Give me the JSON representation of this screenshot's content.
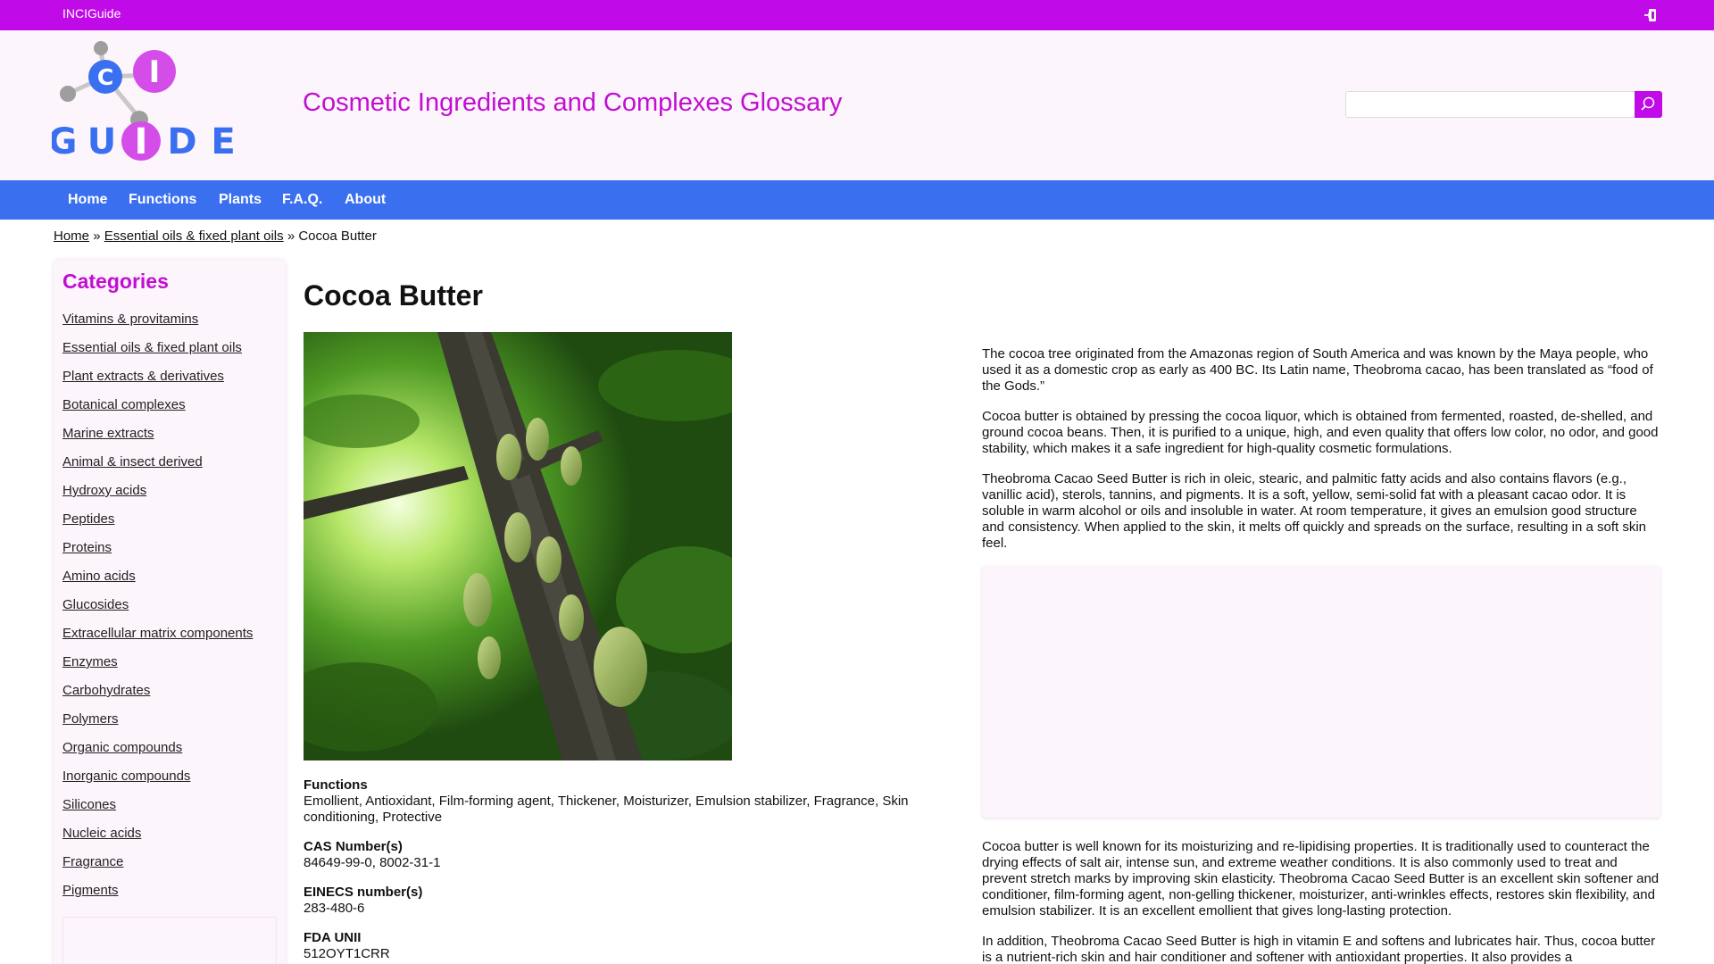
{
  "topbar": {
    "brand": "INCIGuide",
    "login_icon": "login-icon"
  },
  "header": {
    "logo_letters": {
      "c": "C",
      "i": "I",
      "guide": [
        "G",
        "U",
        "I",
        "D",
        "E"
      ]
    },
    "site_title": "Cosmetic Ingredients and Complexes Glossary",
    "search": {
      "value": "",
      "placeholder": "",
      "button_icon": "search-icon"
    },
    "colors": {
      "accent": "#c00ae8",
      "nav": "#3a6ff0",
      "title": "#c20ed2"
    }
  },
  "nav": {
    "items": [
      {
        "label": "Home"
      },
      {
        "label": "Functions"
      },
      {
        "label": "Plants"
      },
      {
        "label": "F.A.Q."
      },
      {
        "label": "About"
      }
    ]
  },
  "breadcrumb": {
    "home": "Home",
    "sep1": "»",
    "category": "Essential oils & fixed plant oils",
    "sep2": "»",
    "current": "Cocoa Butter"
  },
  "sidebar": {
    "title": "Categories",
    "items": [
      "Vitamins & provitamins",
      "Essential oils & fixed plant oils",
      "Plant extracts & derivatives",
      "Botanical complexes",
      "Marine extracts",
      "Animal & insect derived",
      "Hydroxy acids",
      "Peptides",
      "Proteins",
      "Amino acids",
      "Glucosides",
      "Extracellular matrix components",
      "Enzymes",
      "Carbohydrates",
      "Polymers",
      "Organic compounds",
      "Inorganic compounds",
      "Silicones",
      "Nucleic acids",
      "Fragrance",
      "Pigments"
    ]
  },
  "main": {
    "title": "Cocoa Butter",
    "properties": [
      {
        "label": "Functions",
        "value": "Emollient, Antioxidant, Film-forming agent, Thickener, Moisturizer, Emulsion stabilizer, Fragrance, Skin conditioning, Protective"
      },
      {
        "label": "CAS Number(s)",
        "value": "84649-99-0, 8002-31-1"
      },
      {
        "label": "EINECS number(s)",
        "value": "283-480-6"
      },
      {
        "label": "FDA UNII",
        "value": "512OYT1CRR"
      }
    ],
    "paragraphs_top": [
      "The cocoa tree originated from the Amazonas region of South America and was known by the Maya people, who used it as a domestic crop as early as 400 BC. Its Latin name, Theobroma cacao, has been translated as “food of the Gods.”",
      "Cocoa butter is obtained by pressing the cocoa liquor, which is obtained from fermented, roasted, de-shelled, and ground cocoa beans. Then, it is purified to a unique, high, and even quality that offers low color, no odor, and good stability, which makes it a safe ingredient for high-quality cosmetic formulations.",
      "Theobroma Cacao Seed Butter is rich in oleic, stearic, and palmitic fatty acids and also contains flavors (e.g., vanillic acid), sterols, tannins, and pigments. It is a soft, yellow, semi-solid fat with a pleasant cacao odor. It is soluble in warm alcohol or oils and insoluble in water. At room temperature, it gives an emulsion good structure and consistency. When applied to the skin, it melts off quickly and spreads on the surface, resulting in a soft skin feel."
    ],
    "paragraphs_bottom": [
      "Cocoa butter is well known for its moisturizing and re-lipidising properties. It is traditionally used to counteract the drying effects of salt air, intense sun, and extreme weather conditions. It is also commonly used to treat and prevent stretch marks by improving skin elasticity. Theobroma Cacao Seed Butter is an excellent skin softener and conditioner, film-forming agent, non-gelling thickener, moisturizer, anti-wrinkles effects, restores skin flexibility, and emulsion stabilizer. It is an excellent emollient that gives long-lasting protection.",
      "In addition, Theobroma Cacao Seed Butter is high in vitamin E and softens and lubricates hair. Thus, cocoa butter is a nutrient-rich skin and hair conditioner and softener with antioxidant properties. It also provides a"
    ]
  }
}
